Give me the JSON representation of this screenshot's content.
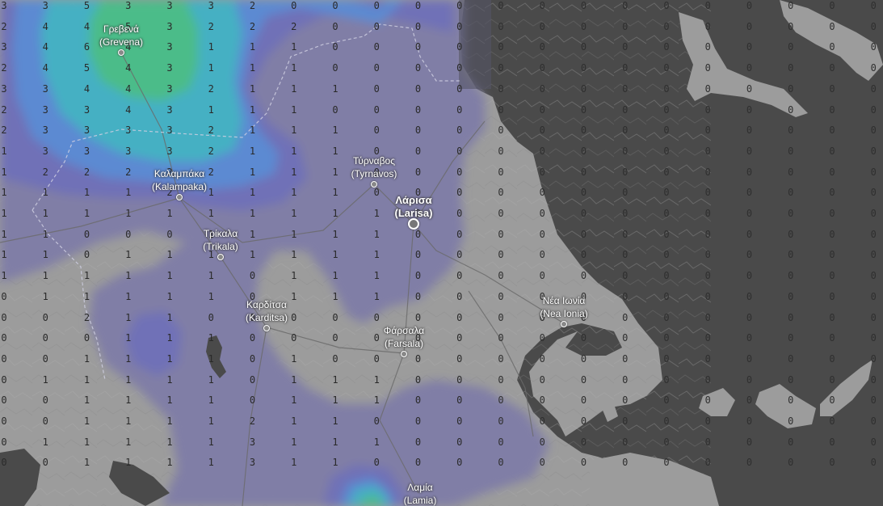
{
  "map": {
    "colors": {
      "sea": "#4a4a4a",
      "land": "#9c9c9c",
      "level_1": "#7e7ca6",
      "level_2": "#6f71b8",
      "level_3": "#5a8bd3",
      "level_4": "#45b2c2",
      "level_5": "#4dbd86",
      "boundary": "#cfcfe2",
      "road": "#6a6a6a"
    },
    "cities": [
      {
        "id": "grevena",
        "name": "Γρεβενά",
        "latin": "(Grevena)"
      },
      {
        "id": "kalampaka",
        "name": "Καλαμπάκα",
        "latin": "(Kalampaka)"
      },
      {
        "id": "tyrnavos",
        "name": "Τύρναβος",
        "latin": "(Tyrnavos)"
      },
      {
        "id": "larisa",
        "name": "Λάρισα",
        "latin": "(Larisa)",
        "major": true
      },
      {
        "id": "trikala",
        "name": "Τρίκαλα",
        "latin": "(Trikala)"
      },
      {
        "id": "karditsa",
        "name": "Καρδίτσα",
        "latin": "(Karditsa)"
      },
      {
        "id": "farsala",
        "name": "Φάρσαλα",
        "latin": "(Farsala)"
      },
      {
        "id": "nea-ionia",
        "name": "Νέα Ιωνία",
        "latin": "(Nea Ionia)"
      },
      {
        "id": "lamia",
        "name": "Λαμία",
        "latin": "(Lamia)"
      }
    ],
    "grid_rows": [
      "3353332000000000000000",
      "2445322200000000000000",
      "3464311100000000000000",
      "2454311100000000000000",
      "3344321110000000000000",
      "2334311100000000000000",
      "2333321110000000000000",
      "1333321110000000000000",
      "1222221110000000000000",
      "1111211110000000000000",
      "1111111111000000000000",
      "1100011111000000000000",
      "1101111111000000000000",
      "1111110111000000000000",
      "0111110111000000000000",
      "0021100000000000000000",
      "0001110000000000000000",
      "0011110100000000000000",
      "0111110111000000000000",
      "0011110111000000000000",
      "0011112110000000000000",
      "0111113111000000000000",
      "0011113110000000000000"
    ]
  }
}
